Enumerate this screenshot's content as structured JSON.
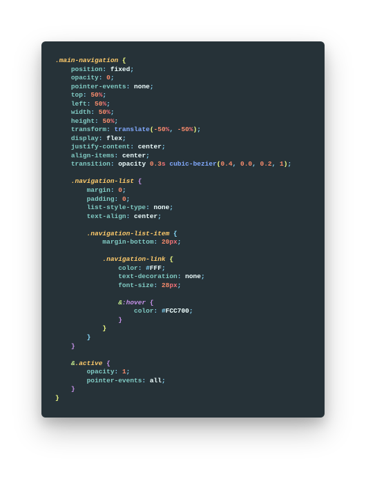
{
  "language": "scss",
  "theme": "material-ocean",
  "code": {
    "selector": ".main-navigation",
    "rules": [
      {
        "prop": "position",
        "value": "fixed"
      },
      {
        "prop": "opacity",
        "value": "0"
      },
      {
        "prop": "pointer-events",
        "value": "none"
      },
      {
        "prop": "top",
        "value": "50%"
      },
      {
        "prop": "left",
        "value": "50%"
      },
      {
        "prop": "width",
        "value": "50%"
      },
      {
        "prop": "height",
        "value": "50%"
      },
      {
        "prop": "transform",
        "value": "translate(-50%, -50%)"
      },
      {
        "prop": "display",
        "value": "flex"
      },
      {
        "prop": "justify-content",
        "value": "center"
      },
      {
        "prop": "align-items",
        "value": "center"
      },
      {
        "prop": "transition",
        "value": "opacity 0.3s cubic-bezier(0.4, 0.0, 0.2, 1)"
      }
    ],
    "children": [
      {
        "selector": ".navigation-list",
        "rules": [
          {
            "prop": "margin",
            "value": "0"
          },
          {
            "prop": "padding",
            "value": "0"
          },
          {
            "prop": "list-style-type",
            "value": "none"
          },
          {
            "prop": "text-align",
            "value": "center"
          }
        ],
        "children": [
          {
            "selector": ".navigation-list-item",
            "rules": [
              {
                "prop": "margin-bottom",
                "value": "20px"
              }
            ],
            "children": [
              {
                "selector": ".navigation-link",
                "rules": [
                  {
                    "prop": "color",
                    "value": "#FFF"
                  },
                  {
                    "prop": "text-decoration",
                    "value": "none"
                  },
                  {
                    "prop": "font-size",
                    "value": "28px"
                  }
                ],
                "children": [
                  {
                    "selector": "&:hover",
                    "rules": [
                      {
                        "prop": "color",
                        "value": "#FCC700"
                      }
                    ]
                  }
                ]
              }
            ]
          }
        ]
      },
      {
        "selector": "&.active",
        "rules": [
          {
            "prop": "opacity",
            "value": "1"
          },
          {
            "prop": "pointer-events",
            "value": "all"
          }
        ]
      }
    ]
  },
  "colors": {
    "background": "#263238",
    "selector": "#FFCB6B",
    "property": "#80CBC4",
    "punctuation": "#89DDFF",
    "number": "#F78C6C",
    "unit": "#F07178",
    "function": "#82AAFF",
    "brace": "#F3FF85",
    "default": "#EEFFFF"
  }
}
